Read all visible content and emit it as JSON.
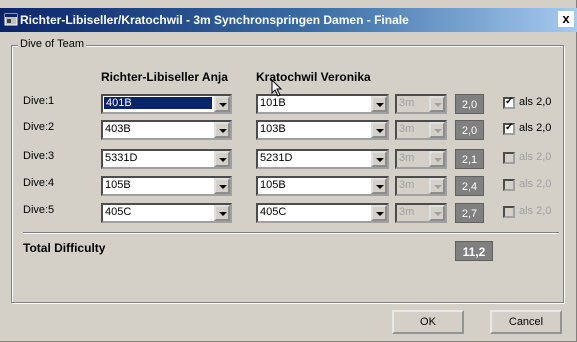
{
  "window": {
    "title": "Richter-Libiseller/Kratochwil - 3m Synchronspringen Damen - Finale",
    "close_label": "x"
  },
  "group": {
    "label": "Dive of Team",
    "diver1_name": "Richter-Libiseller Anja",
    "diver2_name": "Kratochwil Veronika"
  },
  "dives": [
    {
      "label": "Dive:1",
      "diver1": "401B",
      "diver2": "101B",
      "height": "3m",
      "dd": "2,0",
      "as20_checked": true,
      "as20_enabled": true,
      "as20_label": "als 2,0"
    },
    {
      "label": "Dive:2",
      "diver1": "403B",
      "diver2": "103B",
      "height": "3m",
      "dd": "2,0",
      "as20_checked": true,
      "as20_enabled": true,
      "as20_label": "als 2,0"
    },
    {
      "label": "Dive:3",
      "diver1": "5331D",
      "diver2": "5231D",
      "height": "3m",
      "dd": "2,1",
      "as20_checked": false,
      "as20_enabled": false,
      "as20_label": "als 2,0"
    },
    {
      "label": "Dive:4",
      "diver1": "105B",
      "diver2": "105B",
      "height": "3m",
      "dd": "2,4",
      "as20_checked": false,
      "as20_enabled": false,
      "as20_label": "als 2,0"
    },
    {
      "label": "Dive:5",
      "diver1": "405C",
      "diver2": "405C",
      "height": "3m",
      "dd": "2,7",
      "as20_checked": false,
      "as20_enabled": false,
      "as20_label": "als 2,0"
    }
  ],
  "total": {
    "label": "Total Difficulty",
    "value": "11,2"
  },
  "buttons": {
    "ok": "OK",
    "cancel": "Cancel"
  },
  "icons": {
    "window": "app-window-icon",
    "cursor": "mouse-pointer-icon"
  }
}
